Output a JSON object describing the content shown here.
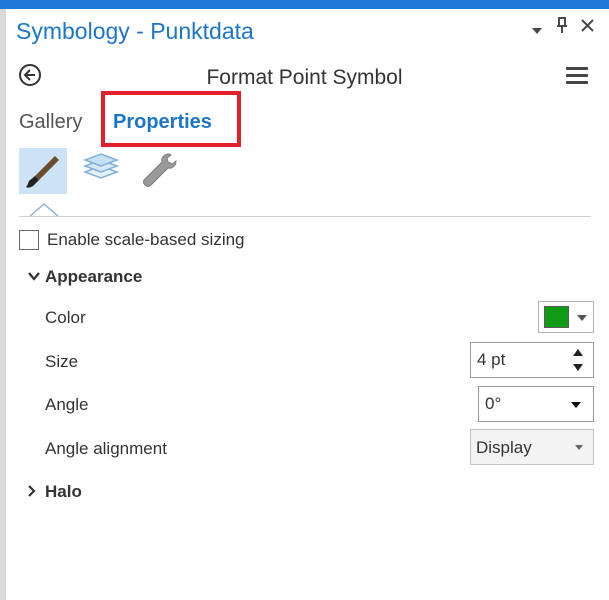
{
  "colors": {
    "accent": "#1c75c9",
    "highlight_box": "#e0202a",
    "active_tool_bg": "#cce3f7",
    "symbol_color": "#0f9b13"
  },
  "pane": {
    "title": "Symbology - Punktdata",
    "controls": {
      "dropdown_icon": "chevron-down-icon",
      "pin_icon": "pin-icon",
      "close_icon": "close-icon"
    }
  },
  "header": {
    "back_icon": "back-arrow-icon",
    "subtitle": "Format Point Symbol",
    "menu_icon": "hamburger-menu-icon"
  },
  "tabs": [
    {
      "label": "Gallery",
      "selected": false
    },
    {
      "label": "Properties",
      "selected": true
    }
  ],
  "tool_tabs": [
    {
      "icon": "paintbrush-icon",
      "selected": true
    },
    {
      "icon": "layers-icon",
      "selected": false
    },
    {
      "icon": "wrench-icon",
      "selected": false
    }
  ],
  "scale_sizing": {
    "label": "Enable scale-based sizing",
    "checked": false
  },
  "appearance": {
    "header": "Appearance",
    "expanded": true,
    "color": {
      "label": "Color"
    },
    "size": {
      "label": "Size",
      "value": "4 pt"
    },
    "angle": {
      "label": "Angle",
      "value": "0°"
    },
    "angle_alignment": {
      "label": "Angle alignment",
      "value": "Display"
    }
  },
  "halo": {
    "header": "Halo",
    "expanded": false
  }
}
